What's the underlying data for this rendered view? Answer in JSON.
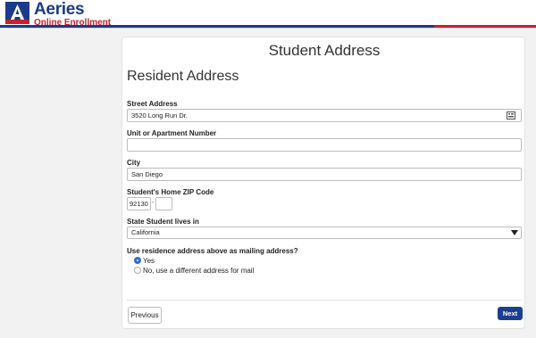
{
  "brand": {
    "name": "Aeries",
    "subtitle": "Online Enrollment",
    "colors": {
      "blue": "#1b3a8a",
      "red": "#c8202f"
    }
  },
  "page": {
    "title": "Student Address",
    "section_title": "Resident Address"
  },
  "form": {
    "street": {
      "label": "Street Address",
      "value": "3520 Long Run Dr.",
      "icon": "address-lookup-icon"
    },
    "unit": {
      "label": "Unit or Apartment Number",
      "value": ""
    },
    "city": {
      "label": "City",
      "value": "San Diego"
    },
    "zip": {
      "label": "Student's Home ZIP Code",
      "value": "92130",
      "ext_value": "",
      "separator": "-"
    },
    "state": {
      "label": "State Student lives in",
      "selected": "California"
    },
    "mailing": {
      "question": "Use residence address above as mailing address?",
      "options": [
        {
          "label": "Yes",
          "checked": true
        },
        {
          "label": "No, use a different address for mail",
          "checked": false
        }
      ]
    }
  },
  "buttons": {
    "previous": "Previous",
    "next": "Next"
  },
  "colors": {
    "primary_button": "#1b3f8f",
    "radio_selected": "#2b6fc9"
  }
}
